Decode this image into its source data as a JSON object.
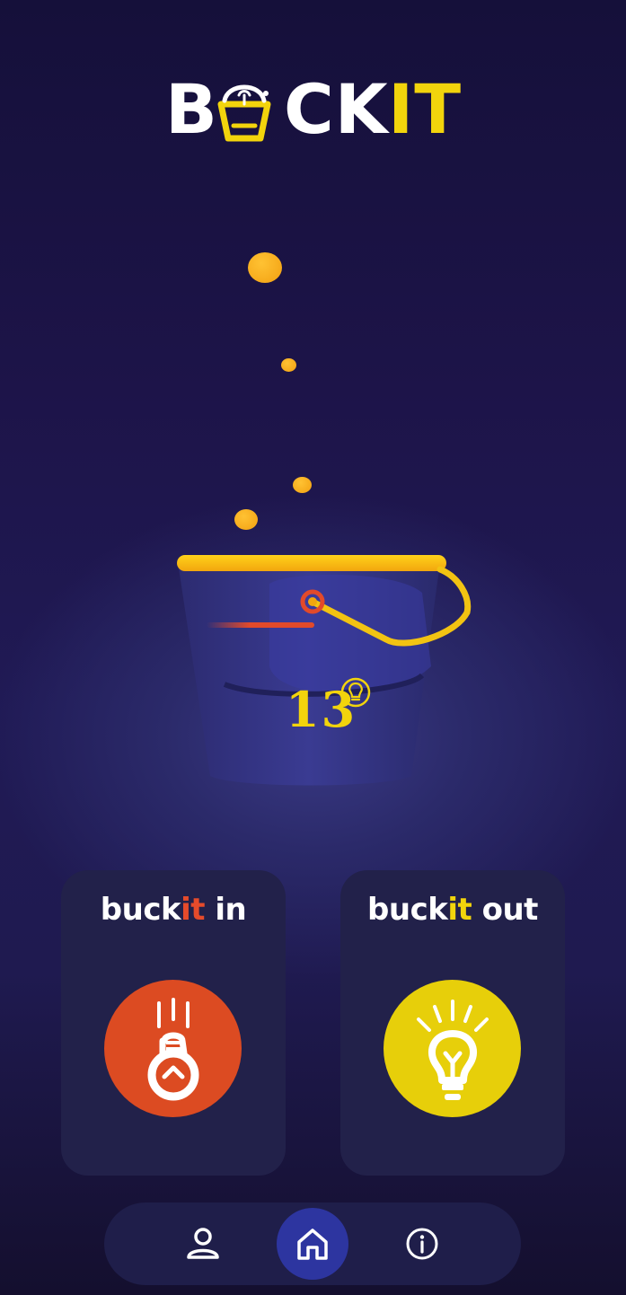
{
  "brand": {
    "logo_prefix": "B",
    "logo_middle": "CK",
    "logo_suffix": "IT"
  },
  "bucket": {
    "count": "13",
    "icon": "lightbulb-circle-icon"
  },
  "cards": {
    "in": {
      "title_prefix": "buck",
      "title_accent": "it",
      "title_suffix": " in",
      "icon": "bulb-drop-in-icon",
      "color": "#dc4b22"
    },
    "out": {
      "title_prefix": "buck",
      "title_accent": "it",
      "title_suffix": " out",
      "icon": "lightbulb-shine-icon",
      "color": "#e7cf0a"
    }
  },
  "nav": {
    "items": [
      {
        "icon": "profile-icon",
        "active": false
      },
      {
        "icon": "home-icon",
        "active": true
      },
      {
        "icon": "info-icon",
        "active": false
      }
    ]
  },
  "colors": {
    "accent_yellow": "#f2d40c",
    "accent_orange": "#e64b2b",
    "card_bg": "#22214a",
    "nav_active": "#2d35a0"
  }
}
